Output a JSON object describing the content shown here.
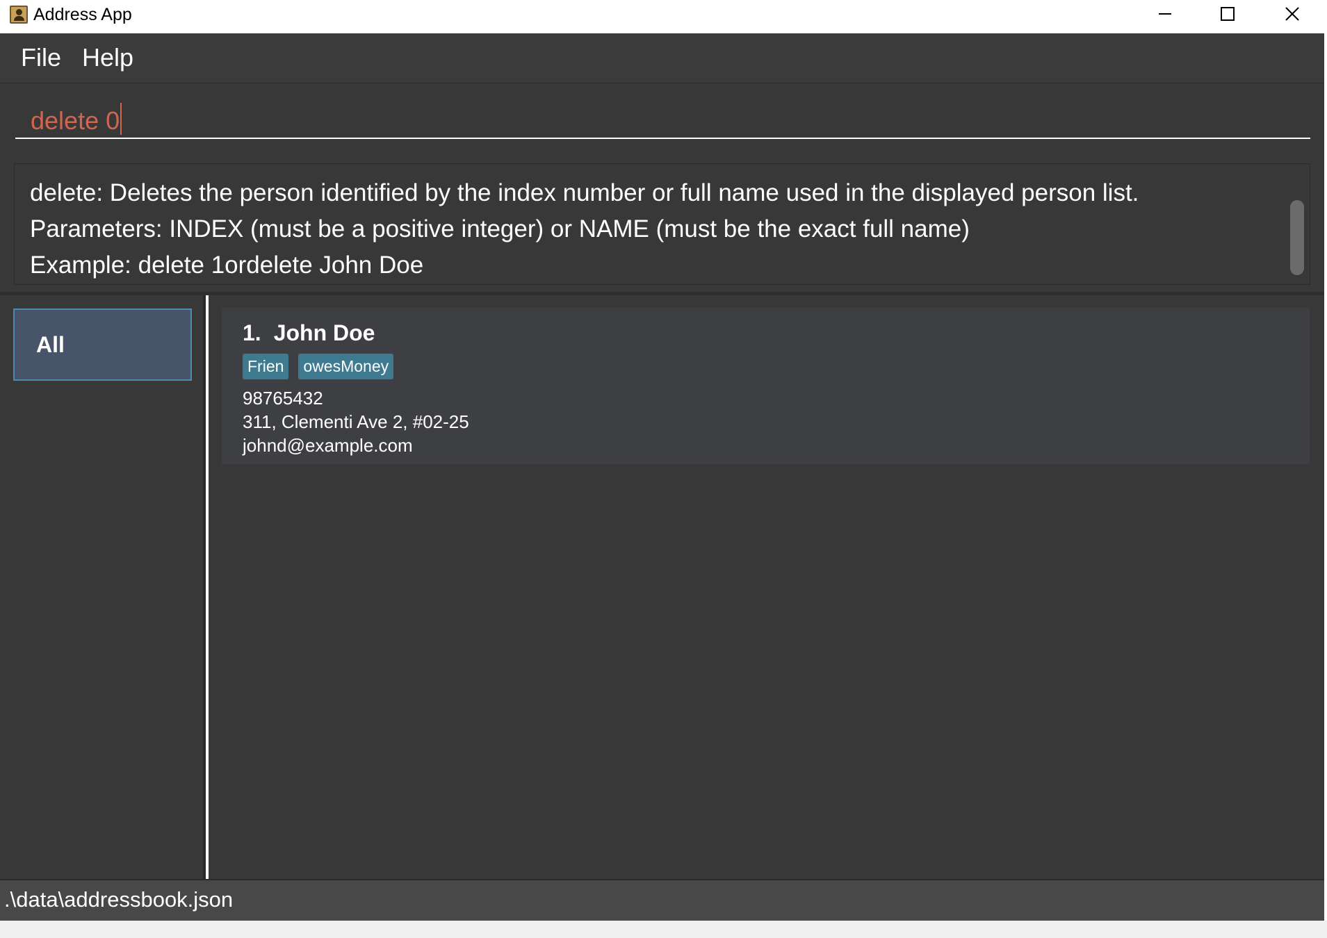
{
  "window": {
    "title": "Address App",
    "app_icon": "address-book-icon"
  },
  "menu": {
    "items": [
      "File",
      "Help"
    ]
  },
  "command": {
    "value": "delete 0",
    "text_color": "#d06651"
  },
  "result": {
    "lines": [
      "delete: Deletes the person identified by the index number or full name used in the displayed person list.",
      "Parameters: INDEX (must be a positive integer) or NAME (must be the exact full name)",
      "Example: delete 1ordelete John Doe"
    ]
  },
  "sidebar": {
    "items": [
      {
        "label": "All",
        "selected": true
      }
    ]
  },
  "persons": [
    {
      "index": "1.",
      "name": "John Doe",
      "tags": [
        "Frien",
        "owesMoney"
      ],
      "phone": "98765432",
      "address": "311, Clementi Ave 2, #02-25",
      "email": "johnd@example.com"
    }
  ],
  "status": {
    "path": ".\\data\\addressbook.json"
  },
  "colors": {
    "background": "#383838",
    "tag": "#3e7b91",
    "selected_item": "#485469",
    "selected_border": "#4b8bad"
  }
}
